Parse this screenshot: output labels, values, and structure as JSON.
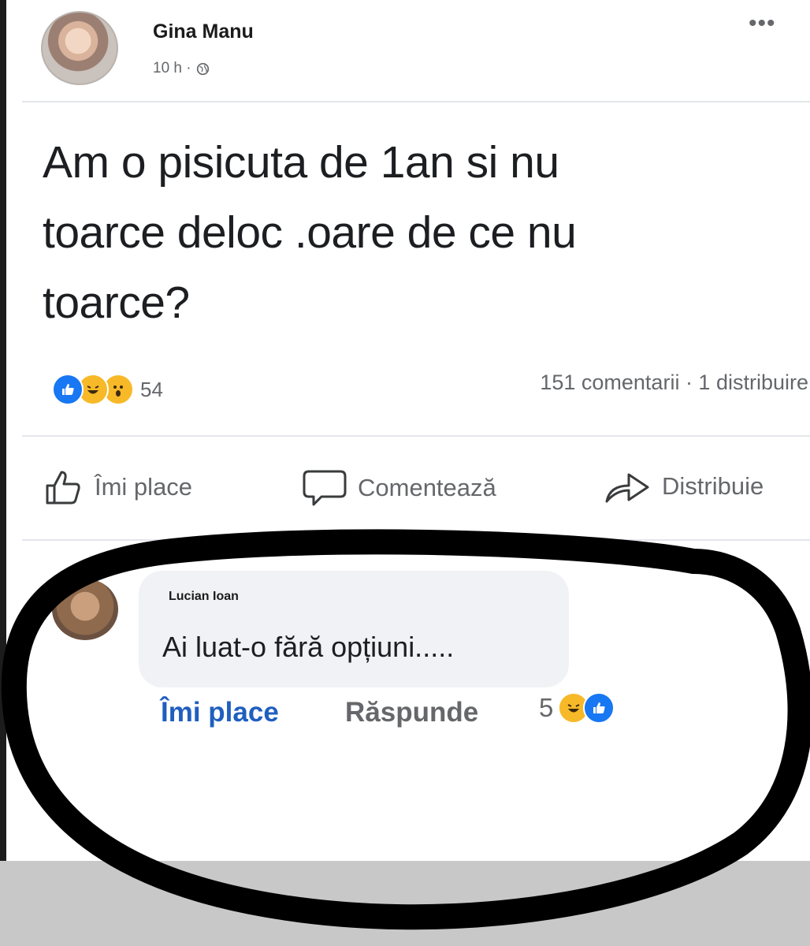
{
  "post": {
    "author": "Gina Manu",
    "meta": "10 h ·",
    "text_line1": "Am o pisicuta de 1an si nu",
    "text_line2": "toarce deloc .oare de ce nu",
    "text_line3": "toarce?",
    "reaction_count": "54",
    "stats": "151 comentarii · 1 distribuire"
  },
  "actions": {
    "like": "Îmi place",
    "comment": "Comentează",
    "share": "Distribuie"
  },
  "comment": {
    "author": "Lucian Ioan",
    "text": "Ai luat-o fără opțiuni.....",
    "like": "Îmi place",
    "reply": "Răspunde",
    "reaction_count": "5"
  },
  "colors": {
    "like_blue": "#1877f2",
    "reaction_yellow": "#f7b928",
    "annotation": "#000000"
  }
}
